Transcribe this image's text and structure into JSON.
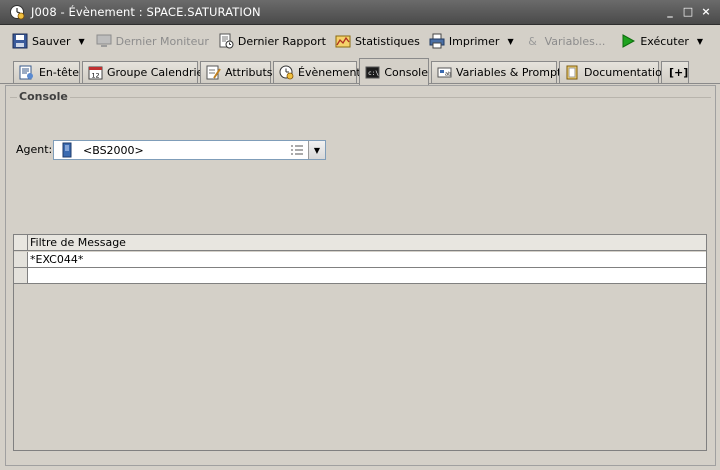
{
  "window": {
    "title": "J008 - Évènement : SPACE.SATURATION",
    "controls": [
      "_",
      "□",
      "×"
    ]
  },
  "toolbar": {
    "save": "Sauver",
    "last_monitor": "Dernier Moniteur",
    "last_report": "Dernier Rapport",
    "statistics": "Statistiques",
    "print": "Imprimer",
    "variables": "Variables...",
    "execute": "Exécuter"
  },
  "tabs": [
    {
      "label": "En-tête",
      "icon": "header-icon"
    },
    {
      "label": "Groupe Calendrier",
      "icon": "calendar-icon"
    },
    {
      "label": "Attributs",
      "icon": "attributes-icon"
    },
    {
      "label": "Évènement",
      "icon": "event-icon"
    },
    {
      "label": "Console",
      "icon": "console-icon",
      "active": true
    },
    {
      "label": "Variables & Prompts",
      "icon": "variables-icon"
    },
    {
      "label": "Documentation",
      "icon": "documentation-icon"
    },
    {
      "label": "[+]",
      "icon": "add-tab-icon"
    }
  ],
  "console": {
    "group_title": "Console",
    "agent_label": "Agent:",
    "agent_value": "<BS2000>",
    "table": {
      "columns": [
        "Filtre de Message"
      ],
      "rows": [
        [
          "*EXC044*"
        ],
        [
          ""
        ]
      ]
    }
  },
  "colors": {
    "titlebar": "#555555",
    "accent_green": "#1fa31f",
    "background": "#d4d0c8"
  }
}
